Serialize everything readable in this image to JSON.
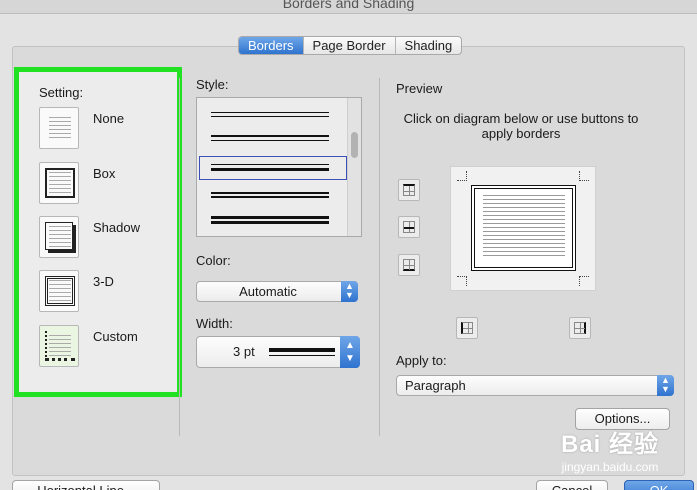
{
  "window": {
    "title": "Borders and Shading"
  },
  "tabs": [
    {
      "label": "Borders",
      "active": true
    },
    {
      "label": "Page Border",
      "active": false
    },
    {
      "label": "Shading",
      "active": false
    }
  ],
  "setting": {
    "title": "Setting:",
    "items": [
      {
        "label": "None",
        "icon": "border-none-icon"
      },
      {
        "label": "Box",
        "icon": "border-box-icon"
      },
      {
        "label": "Shadow",
        "icon": "border-shadow-icon"
      },
      {
        "label": "3-D",
        "icon": "border-3d-icon"
      },
      {
        "label": "Custom",
        "icon": "border-custom-icon",
        "selected": true
      }
    ]
  },
  "style": {
    "label": "Style:"
  },
  "color": {
    "label": "Color:",
    "value": "Automatic"
  },
  "width": {
    "label": "Width:",
    "value": "3 pt"
  },
  "preview": {
    "label": "Preview",
    "hint": "Click on diagram below or use buttons to apply borders"
  },
  "apply": {
    "label": "Apply to:",
    "value": "Paragraph"
  },
  "buttons": {
    "options": "Options...",
    "horizontal_line": "Horizontal Line...",
    "cancel": "Cancel",
    "ok": "OK"
  },
  "watermark": {
    "logo": "Bai 经验",
    "url": "jingyan.baidu.com"
  },
  "colors": {
    "highlight": "#22e022",
    "accent": "#2f73cf"
  }
}
